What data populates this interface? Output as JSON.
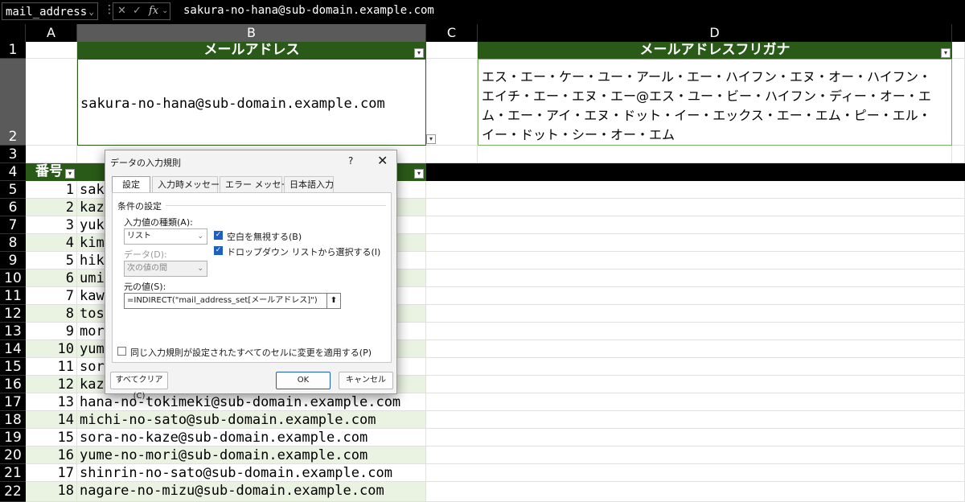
{
  "formula_bar": {
    "name_box": "mail_address",
    "cancel_glyph": "✕",
    "enter_glyph": "✓",
    "fx_label": "fx",
    "formula": "sakura-no-hana@sub-domain.example.com"
  },
  "columns": [
    "A",
    "B",
    "C",
    "D"
  ],
  "rows": [
    "1",
    "2",
    "3",
    "4",
    "5",
    "6",
    "7",
    "8",
    "9",
    "10",
    "11",
    "12",
    "13",
    "14",
    "15",
    "16",
    "17",
    "18",
    "19",
    "20",
    "21",
    "22"
  ],
  "sheet": {
    "b1_header": "メールアドレス",
    "d1_header": "メールアドレスフリガナ",
    "b2_value": "sakura-no-hana@sub-domain.example.com",
    "d2_value": "エス・エー・ケー・ユー・アール・エー・ハイフン・エヌ・オー・ハイフン・エイチ・エー・エヌ・エー@エス・ユー・ビー・ハイフン・ディー・オー・エム・エー・アイ・エヌ・ドット・イー・エックス・エー・エム・ピー・エル・イー・ドット・シー・オー・エム",
    "table_header_no": "番号",
    "table": [
      {
        "no": "1",
        "mail": "sak"
      },
      {
        "no": "2",
        "mail": "kaz"
      },
      {
        "no": "3",
        "mail": "yuk"
      },
      {
        "no": "4",
        "mail": "kim"
      },
      {
        "no": "5",
        "mail": "hik"
      },
      {
        "no": "6",
        "mail": "umi"
      },
      {
        "no": "7",
        "mail": "kaw"
      },
      {
        "no": "8",
        "mail": "tos"
      },
      {
        "no": "9",
        "mail": "mor"
      },
      {
        "no": "10",
        "mail": "yum"
      },
      {
        "no": "11",
        "mail": "sor"
      },
      {
        "no": "12",
        "mail": "kaz"
      },
      {
        "no": "13",
        "mail": "hana-no-tokimeki@sub-domain.example.com"
      },
      {
        "no": "14",
        "mail": "michi-no-sato@sub-domain.example.com"
      },
      {
        "no": "15",
        "mail": "sora-no-kaze@sub-domain.example.com"
      },
      {
        "no": "16",
        "mail": "yume-no-mori@sub-domain.example.com"
      },
      {
        "no": "17",
        "mail": "shinrin-no-sato@sub-domain.example.com"
      },
      {
        "no": "18",
        "mail": "nagare-no-mizu@sub-domain.example.com"
      }
    ]
  },
  "dialog": {
    "title": "データの入力規則",
    "help": "?",
    "close": "✕",
    "tabs": [
      "設定",
      "入力時メッセージ",
      "エラー メッセージ",
      "日本語入力"
    ],
    "group_label": "条件の設定",
    "allow_label": "入力値の種類(A):",
    "allow_value": "リスト",
    "ignore_blank": "空白を無視する(B)",
    "in_cell_dropdown": "ドロップダウン リストから選択する(I)",
    "data_label": "データ(D):",
    "data_value": "次の値の間",
    "source_label": "元の値(S):",
    "source_value": "=INDIRECT(\"mail_address_set[メールアドレス]\")",
    "apply_all": "同じ入力規則が設定されたすべてのセルに変更を適用する(P)",
    "clear_all": "すべてクリア(C)",
    "ok": "OK",
    "cancel": "キャンセル"
  },
  "colors": {
    "header_green": "#2a5a18",
    "row_band": "#eaf2e2",
    "selected_header": "#5a5a5a",
    "accent_blue": "#1f5fbf"
  }
}
